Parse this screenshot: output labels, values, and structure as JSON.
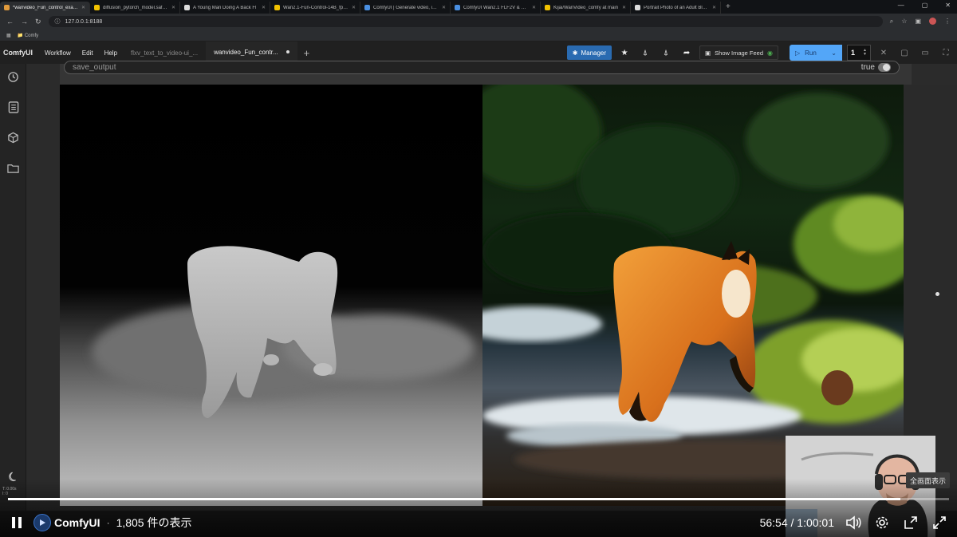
{
  "browser": {
    "tabs": [
      {
        "title": "*wanvideo_Fun_control_example",
        "fav": "#e09a3c",
        "active": true
      },
      {
        "title": "diffusion_pytorch_model.safetens",
        "fav": "#f2c200",
        "active": false
      },
      {
        "title": "A Young Man Doing A Back Fl",
        "fav": "#dddddd",
        "active": false
      },
      {
        "title": "Wan2.1-Fun-Control-14B_fp8_e",
        "fav": "#f2c200",
        "active": false
      },
      {
        "title": "ComfyUI | Generate video, imag",
        "fav": "#4a90e2",
        "active": false
      },
      {
        "title": "ComfyUI Wan2.1 FLF2V & Wan",
        "fav": "#4a90e2",
        "active": false
      },
      {
        "title": "Kijai/WanVideo_comfy at main",
        "fav": "#f2c200",
        "active": false
      },
      {
        "title": "Portrait Photo of an Adult Black",
        "fav": "#dddddd",
        "active": false
      }
    ],
    "url": "127.0.0.1:8188",
    "bookmark": "Comfy"
  },
  "menu": {
    "logo": "ComfyUI",
    "items": [
      "Workflow",
      "Edit",
      "Help"
    ],
    "workflow_tabs": [
      {
        "label": "flxv_text_to_video-ui_...",
        "active": false
      },
      {
        "label": "wanvideo_Fun_contr...",
        "active": true,
        "modified": true
      }
    ],
    "manager_label": "Manager",
    "feed_label": "Show Image Feed",
    "run_label": "Run",
    "batch_count": "1"
  },
  "widget": {
    "name": "save_output",
    "value": "true"
  },
  "sidebar": {
    "build_info": [
      "T: 0.00s",
      "I: 0",
      "N: 0 [0]",
      "V: 25"
    ]
  },
  "overlay": {
    "tooltip": "全画面表示"
  },
  "player": {
    "channel": "ComfyUI",
    "views": "1,805 件の表示",
    "time": "56:54 / 1:00:01",
    "progress": 0.948
  }
}
